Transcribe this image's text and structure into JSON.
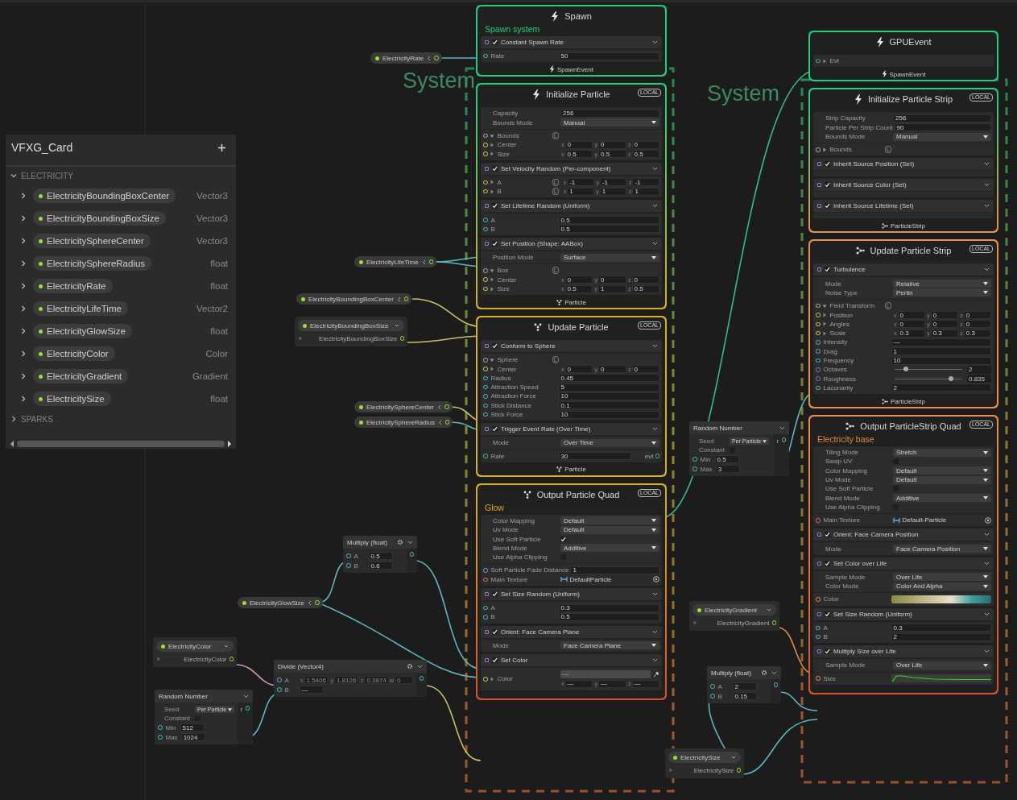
{
  "blackboard": {
    "title": "VFXG_Card",
    "categories": [
      {
        "name": "ELECTRICITY",
        "expanded": true,
        "properties": [
          {
            "name": "ElectricityBoundingBoxCenter",
            "type": "Vector3"
          },
          {
            "name": "ElectricityBoundingBoxSize",
            "type": "Vector3"
          },
          {
            "name": "ElectricitySphereCenter",
            "type": "Vector3"
          },
          {
            "name": "ElectricitySphereRadius",
            "type": "float"
          },
          {
            "name": "ElectricityRate",
            "type": "float"
          },
          {
            "name": "ElectricityLifeTime",
            "type": "Vector2"
          },
          {
            "name": "ElectricityGlowSize",
            "type": "float"
          },
          {
            "name": "ElectricityColor",
            "type": "Color"
          },
          {
            "name": "ElectricityGradient",
            "type": "Gradient"
          },
          {
            "name": "ElectricitySize",
            "type": "float"
          }
        ]
      },
      {
        "name": "SPARKS",
        "expanded": false
      }
    ]
  },
  "systems": [
    {
      "label": "System",
      "contexts": [
        {
          "kind": "spawn",
          "title": "Spawn",
          "subtitle": "Spawn system",
          "blocks": [
            {
              "title": "Constant Spawn Rate",
              "checked": true,
              "inputs": [
                {
                  "kind": "field",
                  "label": "Rate",
                  "value": "50"
                }
              ]
            }
          ],
          "footer": {
            "kind": "event",
            "label": "SpawnEvent"
          }
        },
        {
          "kind": "initialize",
          "title": "Initialize Particle",
          "badge": "LOCAL",
          "settings": [
            {
              "kind": "field",
              "label": "Capacity",
              "value": "256"
            },
            {
              "kind": "dropdown",
              "label": "Bounds Mode",
              "value": "Manual"
            }
          ],
          "inputs": [
            {
              "kind": "group",
              "label": "Bounds",
              "expanded": true,
              "space": "L"
            },
            {
              "kind": "vector",
              "label": "Center",
              "axes": [
                "x",
                "y",
                "z"
              ],
              "values": [
                "0",
                "0",
                "0"
              ]
            },
            {
              "kind": "vector",
              "label": "Size",
              "axes": [
                "x",
                "y",
                "z"
              ],
              "values": [
                "0.5",
                "0.5",
                "0.5"
              ]
            }
          ],
          "blocks": [
            {
              "title": "Set Velocity Random (Per-component)",
              "checked": true,
              "inputs": [
                {
                  "kind": "vector",
                  "label": "A",
                  "space": "L",
                  "axes": [
                    "x",
                    "y",
                    "z"
                  ],
                  "values": [
                    "-1",
                    "-1",
                    "-1"
                  ]
                },
                {
                  "kind": "vector",
                  "label": "B",
                  "space": "L",
                  "axes": [
                    "x",
                    "y",
                    "z"
                  ],
                  "values": [
                    "1",
                    "1",
                    "1"
                  ]
                }
              ]
            },
            {
              "title": "Set Lifetime Random (Uniform)",
              "checked": true,
              "inputs": [
                {
                  "kind": "field",
                  "label": "A",
                  "value": "0.5"
                },
                {
                  "kind": "field",
                  "label": "B",
                  "value": "0.5"
                }
              ]
            },
            {
              "title": "Set Position (Shape: AABox)",
              "checked": true,
              "settings": [
                {
                  "kind": "dropdown",
                  "label": "Position Mode",
                  "value": "Surface"
                }
              ],
              "inputs": [
                {
                  "kind": "group",
                  "label": "Box",
                  "expanded": true,
                  "space": "L"
                },
                {
                  "kind": "vector",
                  "label": "Center",
                  "axes": [
                    "x",
                    "y",
                    "z"
                  ],
                  "values": [
                    "0",
                    "0",
                    "0"
                  ]
                },
                {
                  "kind": "vector",
                  "label": "Size",
                  "axes": [
                    "x",
                    "y",
                    "z"
                  ],
                  "values": [
                    "0.5",
                    "1",
                    "0.5"
                  ]
                }
              ]
            }
          ],
          "footer": {
            "kind": "particle",
            "label": "Particle"
          }
        },
        {
          "kind": "update",
          "title": "Update Particle",
          "badge": "LOCAL",
          "blocks": [
            {
              "title": "Conform to Sphere",
              "checked": true,
              "inputs": [
                {
                  "kind": "group",
                  "label": "Sphere",
                  "expanded": true,
                  "space": "L"
                },
                {
                  "kind": "vector",
                  "label": "Center",
                  "axes": [
                    "x",
                    "y",
                    "z"
                  ],
                  "values": [
                    "0",
                    "0",
                    "0"
                  ]
                },
                {
                  "kind": "field",
                  "label": "Radius",
                  "value": "0.45"
                },
                {
                  "kind": "field",
                  "label": "Attraction Speed",
                  "value": "5"
                },
                {
                  "kind": "field",
                  "label": "Attraction Force",
                  "value": "10"
                },
                {
                  "kind": "field",
                  "label": "Stick Distance",
                  "value": "0.1"
                },
                {
                  "kind": "field",
                  "label": "Stick Force",
                  "value": "10"
                }
              ]
            },
            {
              "title": "Trigger Event Rate (Over Time)",
              "checked": true,
              "settings": [
                {
                  "kind": "dropdown",
                  "label": "Mode",
                  "value": "Over Time"
                }
              ],
              "inputs": [
                {
                  "kind": "field",
                  "label": "Rate",
                  "value": "30",
                  "output": "evt"
                }
              ]
            }
          ],
          "footer": {
            "kind": "particle",
            "label": "Particle"
          }
        },
        {
          "kind": "output",
          "title": "Output Particle Quad",
          "badge": "LOCAL",
          "subtitle": "Glow",
          "settings": [
            {
              "kind": "dropdown",
              "label": "Color Mapping",
              "value": "Default"
            },
            {
              "kind": "dropdown",
              "label": "Uv Mode",
              "value": "Default"
            },
            {
              "kind": "checkbox",
              "label": "Use Soft Particle",
              "checked": true
            },
            {
              "kind": "dropdown",
              "label": "Blend Mode",
              "value": "Additive"
            },
            {
              "kind": "checkbox",
              "label": "Use Alpha Clipping",
              "checked": false
            }
          ],
          "inputs": [
            {
              "kind": "field",
              "label": "Soft Particle Fade Distance",
              "value": "1"
            },
            {
              "kind": "texture",
              "label": "Main Texture",
              "value": "DefaultParticle"
            }
          ],
          "blocks": [
            {
              "title": "Set Size Random (Uniform)",
              "checked": true,
              "inputs": [
                {
                  "kind": "field",
                  "label": "A",
                  "value": "0.3"
                },
                {
                  "kind": "field",
                  "label": "B",
                  "value": "0.5"
                }
              ]
            },
            {
              "title": "Orient: Face Camera Plane",
              "checked": true,
              "settings": [
                {
                  "kind": "dropdown",
                  "label": "Mode",
                  "value": "Face Camera Plane"
                }
              ]
            },
            {
              "title": "Set Color",
              "checked": true,
              "inputs": [
                {
                  "kind": "color",
                  "label": "Color",
                  "value": "—",
                  "axes": [
                    "x",
                    "y",
                    "z"
                  ],
                  "values": [
                    "—",
                    "—",
                    "—"
                  ]
                }
              ]
            }
          ]
        }
      ]
    },
    {
      "label": "System",
      "contexts": [
        {
          "kind": "event",
          "title": "GPUEvent",
          "inputs": [
            {
              "kind": "input",
              "label": "Evt"
            }
          ],
          "footer": {
            "kind": "event",
            "label": "SpawnEvent"
          }
        },
        {
          "kind": "initialize",
          "title": "Initialize Particle Strip",
          "badge": "LOCAL",
          "settings": [
            {
              "kind": "field",
              "label": "Strip Capacity",
              "value": "256"
            },
            {
              "kind": "field",
              "label": "Particle Per Strip Count",
              "value": "90"
            },
            {
              "kind": "dropdown",
              "label": "Bounds Mode",
              "value": "Manual"
            }
          ],
          "inputs": [
            {
              "kind": "group",
              "label": "Bounds",
              "expanded": false,
              "space": "L"
            }
          ],
          "blocks": [
            {
              "title": "Inherit Source Position (Set)",
              "checked": true
            },
            {
              "title": "Inherit Source Color (Set)",
              "checked": true
            },
            {
              "title": "Inherit Source Lifetime (Set)",
              "checked": true
            }
          ],
          "footer": {
            "kind": "strip",
            "label": "ParticleStrip"
          }
        },
        {
          "kind": "stripupdate",
          "title": "Update Particle Strip",
          "badge": "LOCAL",
          "blocks": [
            {
              "title": "Turbulence",
              "checked": true,
              "settings": [
                {
                  "kind": "dropdown",
                  "label": "Mode",
                  "value": "Relative"
                },
                {
                  "kind": "dropdown",
                  "label": "Noise Type",
                  "value": "Perlin"
                }
              ],
              "inputs": [
                {
                  "kind": "group",
                  "label": "Field Transform",
                  "expanded": true,
                  "space": "L"
                },
                {
                  "kind": "vector",
                  "label": "Position",
                  "axes": [
                    "x",
                    "y",
                    "z"
                  ],
                  "values": [
                    "0",
                    "0",
                    "0"
                  ]
                },
                {
                  "kind": "vector",
                  "label": "Angles",
                  "axes": [
                    "x",
                    "y",
                    "z"
                  ],
                  "values": [
                    "0",
                    "0",
                    "0"
                  ]
                },
                {
                  "kind": "vector",
                  "label": "Scale",
                  "axes": [
                    "x",
                    "y",
                    "z"
                  ],
                  "values": [
                    "0.3",
                    "0.3",
                    "0.3"
                  ]
                },
                {
                  "kind": "field",
                  "label": "Intensity",
                  "value": "—"
                },
                {
                  "kind": "field",
                  "label": "Drag",
                  "value": "1"
                },
                {
                  "kind": "field",
                  "label": "Frequency",
                  "value": "10"
                },
                {
                  "kind": "slider",
                  "label": "Octaves",
                  "level": 0.17,
                  "value": "2"
                },
                {
                  "kind": "slider",
                  "label": "Roughness",
                  "level": 0.83,
                  "value": "0.835"
                },
                {
                  "kind": "field",
                  "label": "Lacunarity",
                  "value": "2"
                }
              ]
            }
          ],
          "footer": {
            "kind": "strip",
            "label": "ParticleStrip"
          }
        },
        {
          "kind": "stripoutput",
          "title": "Output ParticleStrip Quad",
          "badge": "LOCAL",
          "subtitle": "Electricity base",
          "settings": [
            {
              "kind": "dropdown",
              "label": "Tiling Mode",
              "value": "Stretch"
            },
            {
              "kind": "checkbox",
              "label": "Swap UV",
              "checked": false
            },
            {
              "kind": "dropdown",
              "label": "Color Mapping",
              "value": "Default"
            },
            {
              "kind": "dropdown",
              "label": "Uv Mode",
              "value": "Default"
            },
            {
              "kind": "checkbox",
              "label": "Use Soft Particle",
              "checked": false
            },
            {
              "kind": "dropdown",
              "label": "Blend Mode",
              "value": "Additive"
            },
            {
              "kind": "checkbox",
              "label": "Use Alpha Clipping",
              "checked": false
            }
          ],
          "inputs": [
            {
              "kind": "texture",
              "label": "Main Texture",
              "value": "Default-Particle"
            }
          ],
          "blocks": [
            {
              "title": "Orient: Face Camera Position",
              "checked": true,
              "settings": [
                {
                  "kind": "dropdown",
                  "label": "Mode",
                  "value": "Face Camera Position"
                }
              ]
            },
            {
              "title": "Set Color over Life",
              "checked": true,
              "settings": [
                {
                  "kind": "dropdown",
                  "label": "Sample Mode",
                  "value": "Over Life"
                },
                {
                  "kind": "dropdown",
                  "label": "Color Mode",
                  "value": "Color And Alpha"
                }
              ],
              "inputs": [
                {
                  "kind": "gradient",
                  "label": "Color"
                }
              ]
            },
            {
              "title": "Set Size Random (Uniform)",
              "checked": true,
              "inputs": [
                {
                  "kind": "field",
                  "label": "A",
                  "value": "0.3"
                },
                {
                  "kind": "field",
                  "label": "B",
                  "value": "2"
                }
              ]
            },
            {
              "title": "Multiply Size over Life",
              "checked": true,
              "settings": [
                {
                  "kind": "dropdown",
                  "label": "Sample Mode",
                  "value": "Over Life"
                }
              ],
              "inputs": [
                {
                  "kind": "curve",
                  "label": "Size"
                }
              ]
            }
          ]
        }
      ]
    }
  ],
  "nodes": [
    {
      "kind": "pill",
      "name": "ElectricityRate"
    },
    {
      "kind": "pill",
      "name": "ElectricityLifeTime"
    },
    {
      "kind": "pill",
      "name": "ElectricityBoundingBoxCenter"
    },
    {
      "kind": "property",
      "name": "ElectricityBoundingBoxSize",
      "output": "ElectricityBoundingBoxSize"
    },
    {
      "kind": "pill",
      "name": "ElectricitySphereCenter"
    },
    {
      "kind": "pill",
      "name": "ElectricitySphereRadius"
    },
    {
      "kind": "operator",
      "title": "Random Number",
      "settings": [
        {
          "kind": "dropdown",
          "label": "Seed",
          "value": "Per Particle"
        },
        {
          "kind": "checkbox",
          "label": "Constant",
          "checked": false
        }
      ],
      "inputs": [
        {
          "label": "Min",
          "value": "0.5"
        },
        {
          "label": "Max",
          "value": "3"
        }
      ],
      "output": "r"
    },
    {
      "kind": "operator",
      "title": "Multiply (float)",
      "inputs": [
        {
          "label": "A",
          "value": "0.5"
        },
        {
          "label": "B",
          "value": "0.6"
        }
      ]
    },
    {
      "kind": "pill",
      "name": "ElectricityGlowSize"
    },
    {
      "kind": "property",
      "name": "ElectricityColor",
      "output": "ElectricityColor"
    },
    {
      "kind": "operator",
      "title": "Divide (Vector4)",
      "inputs": [
        {
          "label": "A",
          "axes": [
            "x",
            "y",
            "z",
            "w"
          ],
          "values": [
            "1.5406",
            "1.8126",
            "0.3874",
            "0"
          ]
        },
        {
          "label": "B",
          "value": "—"
        }
      ]
    },
    {
      "kind": "operator",
      "title": "Random Number",
      "settings": [
        {
          "kind": "dropdown",
          "label": "Seed",
          "value": "Per Particle"
        },
        {
          "kind": "checkbox",
          "label": "Constant",
          "checked": false
        }
      ],
      "inputs": [
        {
          "label": "Min",
          "value": "512"
        },
        {
          "label": "Max",
          "value": "1024"
        }
      ],
      "output": "r"
    },
    {
      "kind": "property",
      "name": "ElectricityGradient",
      "output": "ElectricityGradient"
    },
    {
      "kind": "operator",
      "title": "Multiply (float)",
      "inputs": [
        {
          "label": "A",
          "value": "2"
        },
        {
          "label": "B",
          "value": "0.15"
        }
      ]
    },
    {
      "kind": "property",
      "name": "ElectricitySize",
      "output": "ElectricitySize"
    }
  ]
}
